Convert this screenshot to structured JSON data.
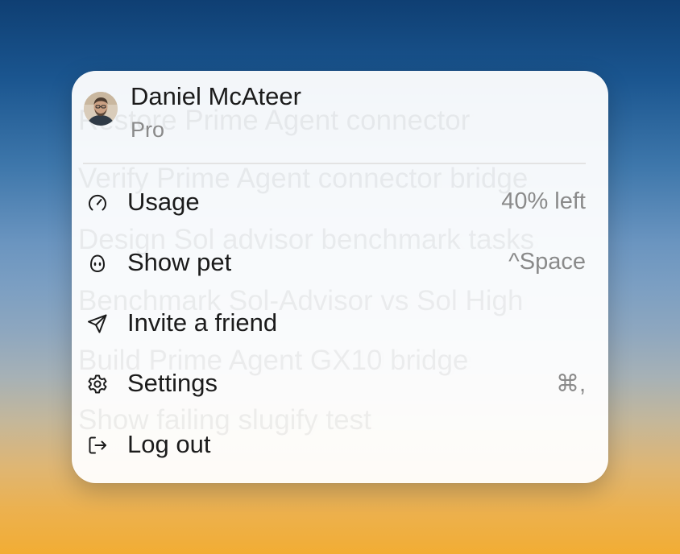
{
  "background_tasks": [
    "Restore Prime Agent connector",
    "Verify Prime Agent connector bridge",
    "Design Sol advisor benchmark tasks",
    "Benchmark Sol-Advisor vs Sol High",
    "Build Prime Agent GX10 bridge",
    "Show failing slugify test"
  ],
  "account_menu": {
    "user": {
      "name": "Daniel McAteer",
      "plan": "Pro",
      "avatar_icon": "user-avatar"
    },
    "items": [
      {
        "label": "Usage",
        "icon": "gauge-icon",
        "trailing": "40% left",
        "usage_remaining_percent": 40
      },
      {
        "label": "Show pet",
        "icon": "pet-icon",
        "trailing": "^Space"
      },
      {
        "label": "Invite a friend",
        "icon": "paper-plane-icon",
        "trailing": ""
      },
      {
        "label": "Settings",
        "icon": "gear-icon",
        "trailing": "⌘,"
      },
      {
        "label": "Log out",
        "icon": "log-out-icon",
        "trailing": ""
      }
    ]
  },
  "colors": {
    "menu_background": "#ffffff",
    "text_primary": "#1b1b1b",
    "text_secondary": "#8a8a8a",
    "divider": "#e3e3e3",
    "backdrop_top": "#0f3f73",
    "backdrop_bottom": "#f2ad34"
  }
}
